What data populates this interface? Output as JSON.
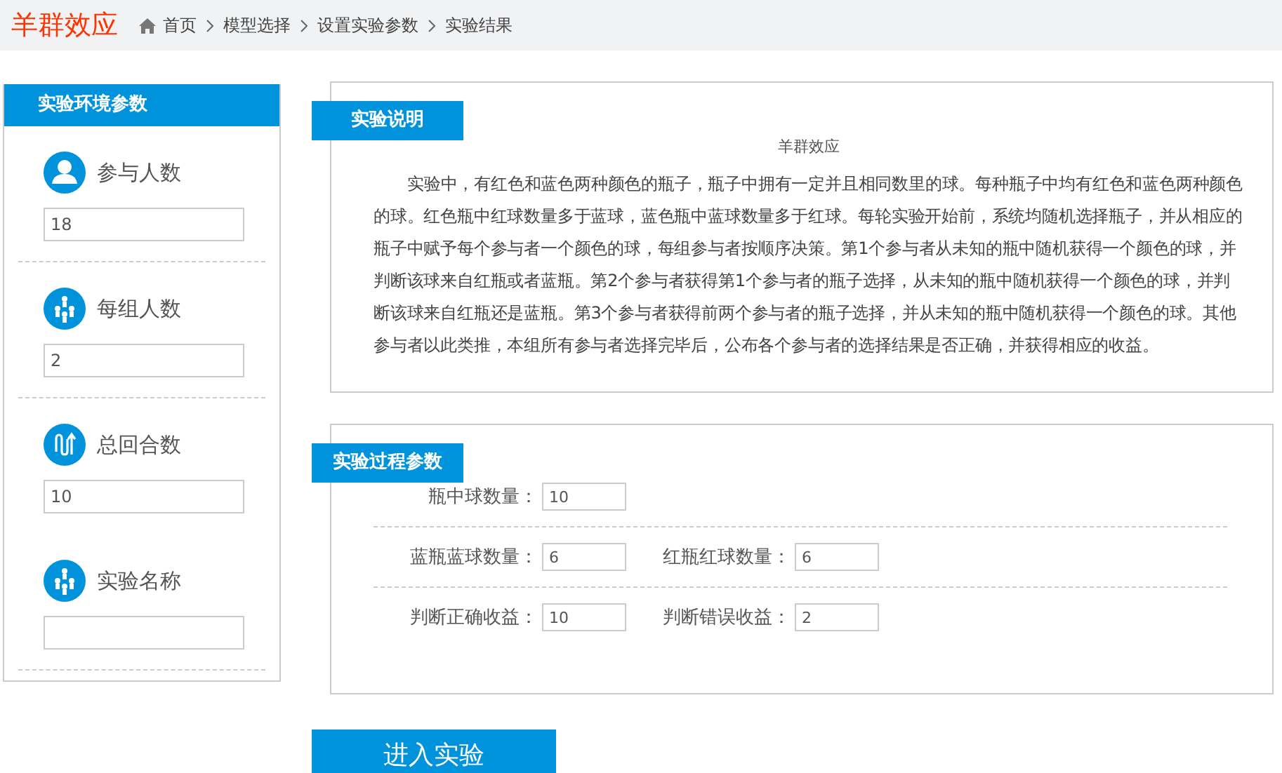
{
  "header": {
    "title": "羊群效应",
    "breadcrumbs": [
      "首页",
      "模型选择",
      "设置实验参数",
      "实验结果"
    ]
  },
  "sidebar": {
    "title": "实验环境参数",
    "items": [
      {
        "kind": "person",
        "label": "参与人数",
        "value": "18",
        "divider": true
      },
      {
        "kind": "group",
        "label": "每组人数",
        "value": "2",
        "divider": true
      },
      {
        "kind": "rounds",
        "label": "总回合数",
        "value": "10",
        "divider": false
      },
      {
        "kind": "group",
        "label": "实验名称",
        "value": "",
        "divider": true
      }
    ]
  },
  "description": {
    "tab": "实验说明",
    "heading": "羊群效应",
    "text": "实验中，有红色和蓝色两种颜色的瓶子，瓶子中拥有一定并且相同数里的球。每种瓶子中均有红色和蓝色两种颜色的球。红色瓶中红球数量多于蓝球，蓝色瓶中蓝球数量多于红球。每轮实验开始前，系统均随机选择瓶子，并从相应的瓶子中赋予每个参与者一个颜色的球，每组参与者按顺序决策。第1个参与者从未知的瓶中随机获得一个颜色的球，并判断该球来自红瓶或者蓝瓶。第2个参与者获得第1个参与者的瓶子选择，从未知的瓶中随机获得一个颜色的球，并判断该球来自红瓶还是蓝瓶。第3个参与者获得前两个参与者的瓶子选择，并从未知的瓶中随机获得一个颜色的球。其他参与者以此类推，本组所有参与者选择完毕后，公布各个参与者的选择结果是否正确，并获得相应的收益。"
  },
  "process": {
    "tab": "实验过程参数",
    "rows": [
      [
        {
          "label": "瓶中球数量：",
          "value": "10"
        }
      ],
      [
        {
          "label": "蓝瓶蓝球数量：",
          "value": "6"
        },
        {
          "label": "红瓶红球数量：",
          "value": "6"
        }
      ],
      [
        {
          "label": "判断正确收益：",
          "value": "10"
        },
        {
          "label": "判断错误收益：",
          "value": "2"
        }
      ]
    ]
  },
  "button": "进入实验"
}
